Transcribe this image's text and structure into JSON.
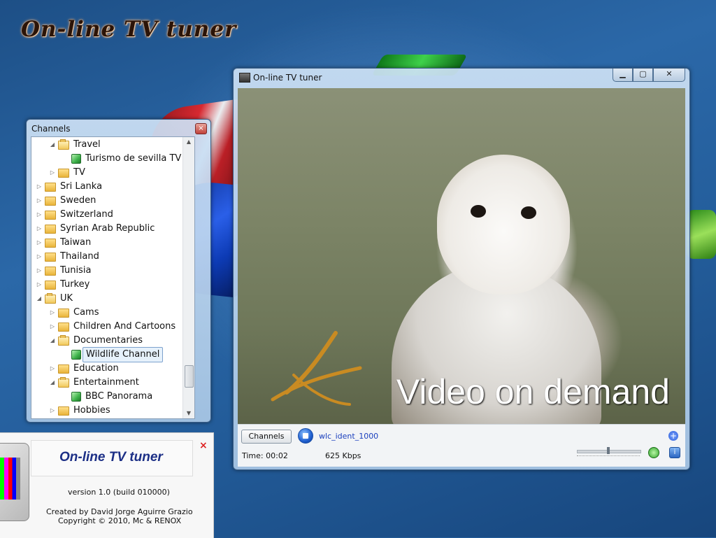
{
  "desktop": {
    "title": "On-line TV tuner"
  },
  "channels_window": {
    "title": "Channels",
    "close_glyph": "×",
    "tree": [
      {
        "label": "Travel",
        "level": 2,
        "expanded": true,
        "type": "folder"
      },
      {
        "label": "Turismo de sevilla TV",
        "level": 3,
        "type": "channel"
      },
      {
        "label": "TV",
        "level": 2,
        "expanded": false,
        "type": "folder"
      },
      {
        "label": "Sri Lanka",
        "level": 1,
        "expanded": false,
        "type": "folder"
      },
      {
        "label": "Sweden",
        "level": 1,
        "expanded": false,
        "type": "folder"
      },
      {
        "label": "Switzerland",
        "level": 1,
        "expanded": false,
        "type": "folder"
      },
      {
        "label": "Syrian Arab Republic",
        "level": 1,
        "expanded": false,
        "type": "folder"
      },
      {
        "label": "Taiwan",
        "level": 1,
        "expanded": false,
        "type": "folder"
      },
      {
        "label": "Thailand",
        "level": 1,
        "expanded": false,
        "type": "folder"
      },
      {
        "label": "Tunisia",
        "level": 1,
        "expanded": false,
        "type": "folder"
      },
      {
        "label": "Turkey",
        "level": 1,
        "expanded": false,
        "type": "folder"
      },
      {
        "label": "UK",
        "level": 1,
        "expanded": true,
        "type": "folder"
      },
      {
        "label": "Cams",
        "level": 2,
        "expanded": false,
        "type": "folder"
      },
      {
        "label": "Children And Cartoons",
        "level": 2,
        "expanded": false,
        "type": "folder"
      },
      {
        "label": "Documentaries",
        "level": 2,
        "expanded": true,
        "type": "folder"
      },
      {
        "label": "Wildlife Channel",
        "level": 3,
        "type": "channel",
        "selected": true
      },
      {
        "label": "Education",
        "level": 2,
        "expanded": false,
        "type": "folder"
      },
      {
        "label": "Entertainment",
        "level": 2,
        "expanded": true,
        "type": "folder"
      },
      {
        "label": "BBC Panorama",
        "level": 3,
        "type": "channel"
      },
      {
        "label": "Hobbies",
        "level": 2,
        "expanded": false,
        "type": "folder"
      }
    ]
  },
  "player_window": {
    "title": "On-line TV tuner",
    "caption_buttons": {
      "minimize": "▁",
      "maximize": "▢",
      "close": "✕"
    },
    "video_overlay_text": "Video on demand",
    "channels_button": "Channels",
    "clip_name": "wlc_ident_1000",
    "time": "Time: 00:02",
    "bitrate": "625 Kbps",
    "volume_level": 0.5,
    "add_glyph": "+",
    "info_glyph": "i"
  },
  "about_box": {
    "title": "On-line TV tuner",
    "close_glyph": "×",
    "version": "version 1.0 (build 010000)",
    "credit": "Created by David Jorge Aguirre Grazio",
    "copyright": "Copyright © 2010, Mc & RENOX"
  },
  "colors": {
    "desktop_bg": "#245e9c",
    "link_blue": "#1a3fbd",
    "about_title_blue": "#1c2f86"
  }
}
